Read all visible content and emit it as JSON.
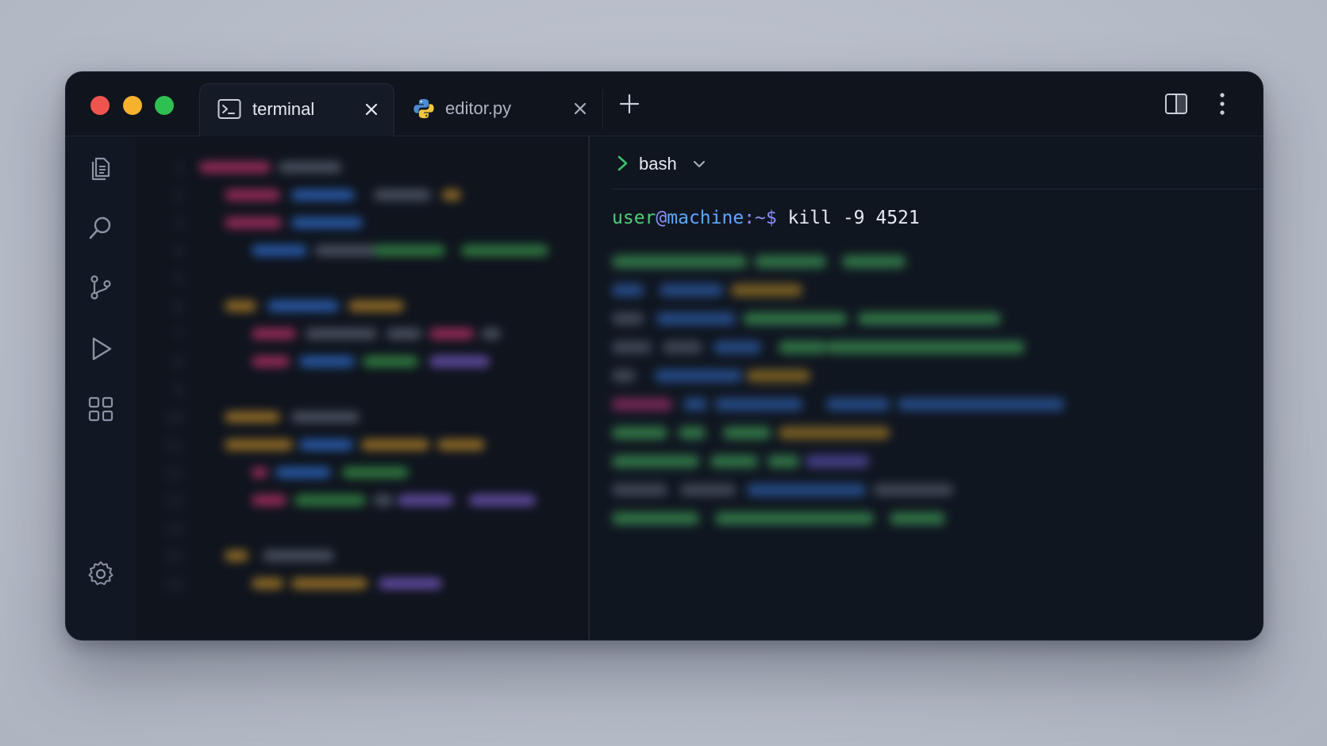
{
  "window": {
    "tabs": [
      {
        "label": "terminal",
        "icon": "terminal-icon",
        "active": true
      },
      {
        "label": "editor.py",
        "icon": "python-icon",
        "active": false
      }
    ]
  },
  "editor": {
    "line_numbers": [
      "1",
      "2",
      "3",
      "4",
      "5",
      "6",
      "7",
      "8",
      "9",
      "10",
      "11",
      "12",
      "13",
      "14",
      "15",
      "16"
    ]
  },
  "terminal": {
    "shell": "bash",
    "prompt": {
      "user": "user",
      "at": "@",
      "host": "machine",
      "path": ":~$",
      "command": " kill -9 4521"
    }
  },
  "colors": {
    "window_bg": "#111722",
    "prompt_user": "#4fce7a",
    "prompt_host": "#5fa8ff",
    "prompt_path": "#8b8ff5",
    "traffic_red": "#f0544e",
    "traffic_yellow": "#f6b12d",
    "traffic_green": "#2fc052"
  }
}
